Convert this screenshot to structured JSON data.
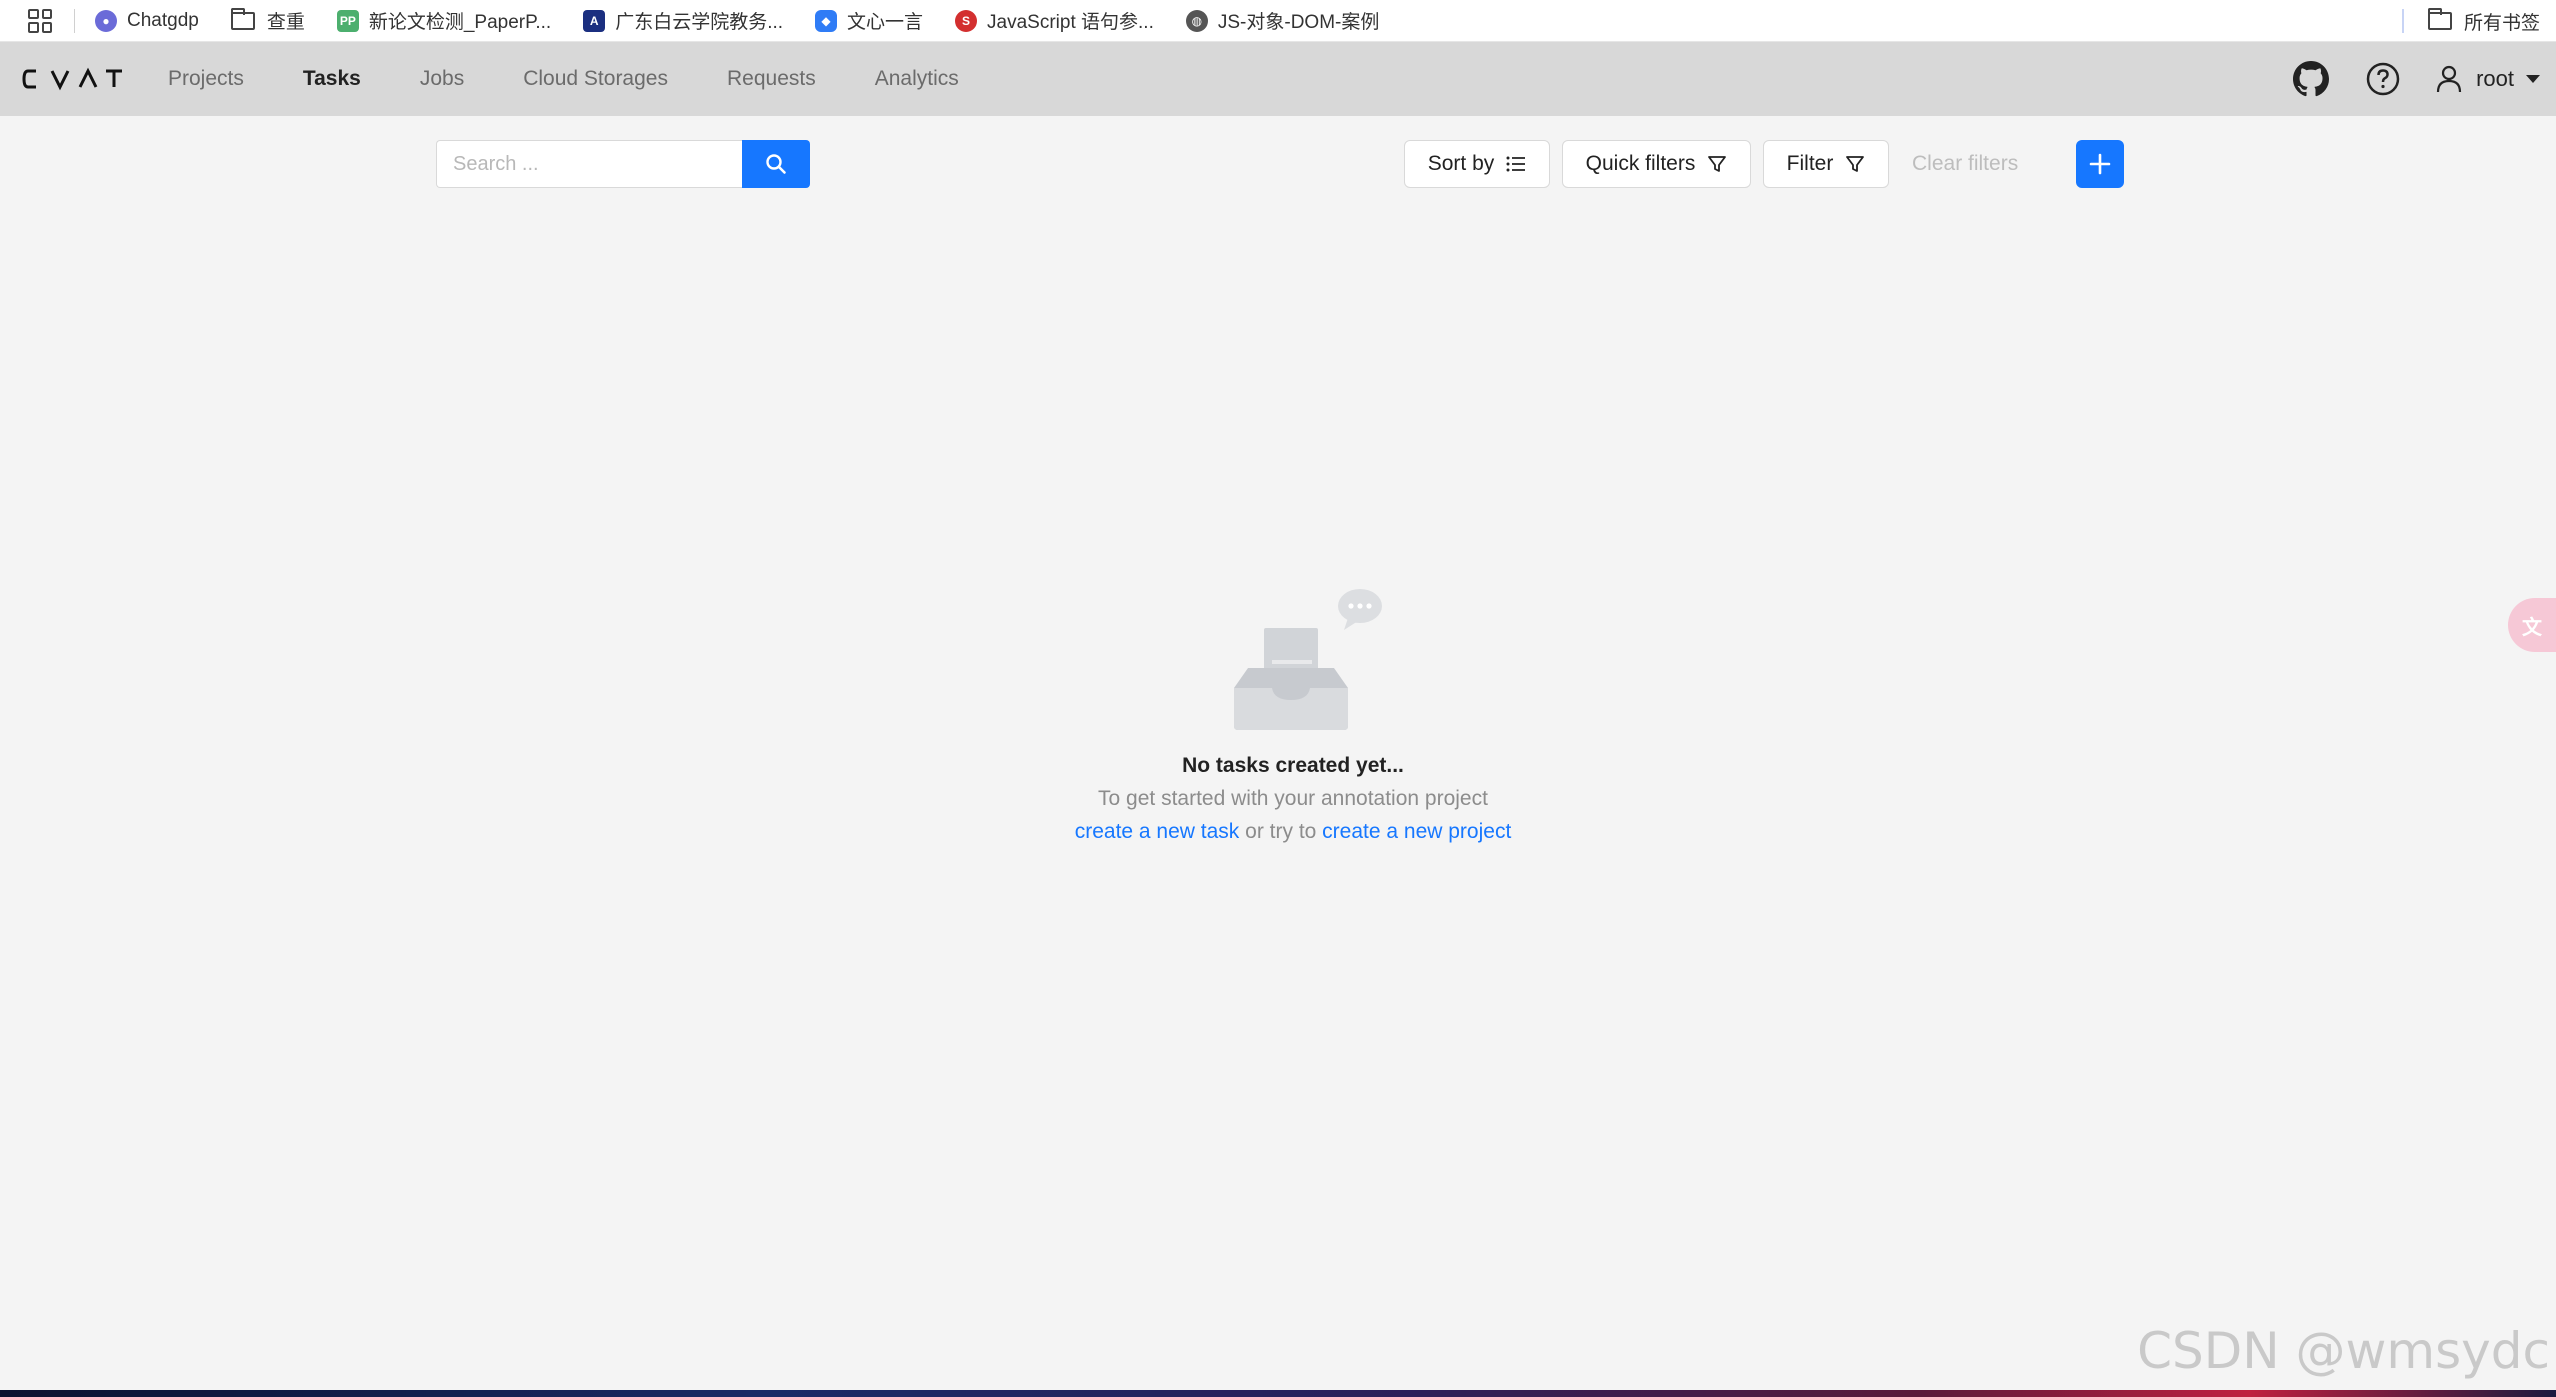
{
  "bookmarks": {
    "items": [
      {
        "label": "Chatgdp",
        "icon": "chatgpt-icon"
      },
      {
        "label": "查重",
        "icon": "folder-icon"
      },
      {
        "label": "新论文检测_PaperP...",
        "icon": "paperpass-icon"
      },
      {
        "label": "广东白云学院教务...",
        "icon": "school-icon"
      },
      {
        "label": "文心一言",
        "icon": "wenxin-icon"
      },
      {
        "label": "JavaScript 语句参...",
        "icon": "javascript-icon"
      },
      {
        "label": "JS-对象-DOM-案例",
        "icon": "globe-icon"
      }
    ],
    "all_bookmarks": "所有书签"
  },
  "header": {
    "logo": "CVAT",
    "nav": [
      {
        "label": "Projects"
      },
      {
        "label": "Tasks",
        "active": true
      },
      {
        "label": "Jobs"
      },
      {
        "label": "Cloud Storages"
      },
      {
        "label": "Requests"
      },
      {
        "label": "Analytics"
      }
    ],
    "user": "root"
  },
  "toolbar": {
    "search_placeholder": "Search ...",
    "sort_label": "Sort by",
    "quick_filters_label": "Quick filters",
    "filter_label": "Filter",
    "clear_filters_label": "Clear filters",
    "accent_color": "#1677ff"
  },
  "empty": {
    "title": "No tasks created yet...",
    "description": "To get started with your annotation project",
    "link_task": "create a new task",
    "middle": " or try to ",
    "link_project": "create a new project"
  },
  "watermark": "CSDN @wmsydc"
}
